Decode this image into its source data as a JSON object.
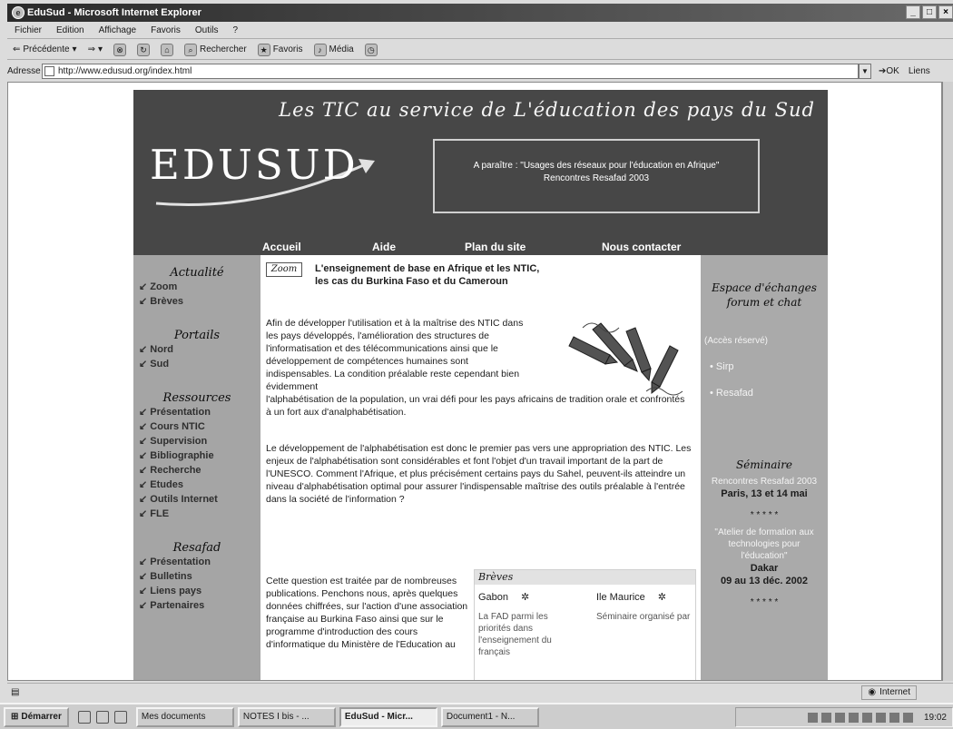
{
  "window": {
    "title": "EduSud - Microsoft Internet Explorer",
    "controls": [
      "_",
      "□",
      "×"
    ]
  },
  "menu": [
    "Fichier",
    "Edition",
    "Affichage",
    "Favoris",
    "Outils",
    "?"
  ],
  "toolbar": {
    "back": "Précédente",
    "search": "Rechercher",
    "favorites": "Favoris",
    "media": "Média"
  },
  "address": {
    "label": "Adresse",
    "url": "http://www.edusud.org/index.html",
    "go": "OK",
    "links": "Liens"
  },
  "site": {
    "tagline": "Les TIC au service de L'éducation des pays du Sud",
    "logo": "EDUSUD",
    "announce_line1": "A paraître : \"Usages des réseaux pour l'éducation en Afrique\"",
    "announce_line2": "Rencontres Resafad 2003",
    "nav": [
      "Accueil",
      "Aide",
      "Plan du site",
      "Nous contacter"
    ],
    "left": {
      "actualite_title": "Actualité",
      "actualite": [
        "Zoom",
        "Brèves"
      ],
      "portails_title": "Portails",
      "portails": [
        "Nord",
        "Sud"
      ],
      "ressources_title": "Ressources",
      "ressources": [
        "Présentation",
        "Cours NTIC",
        "Supervision",
        "Bibliographie",
        "Recherche",
        "Etudes",
        "Outils Internet",
        "FLE"
      ],
      "resafad_title": "Resafad",
      "resafad": [
        "Présentation",
        "Bulletins",
        "Liens pays",
        "Partenaires"
      ]
    },
    "article": {
      "tag": "Zoom",
      "title_line1": "L'enseignement de base en Afrique et les NTIC,",
      "title_line2": "les cas du Burkina Faso et du Cameroun",
      "p1": "Afin de développer l'utilisation et à la maîtrise des NTIC dans les pays développés, l'amélioration des structures de l'informatisation et des télécommunications ainsi que le développement de compétences humaines sont indispensables. La condition préalable reste cependant bien évidemment",
      "p1b": "l'alphabétisation de la population, un vrai défi pour les pays africains de tradition orale et confrontés à un fort aux d'analphabétisation.",
      "p2": "Le développement de l'alphabétisation est donc le premier pas vers une appropriation des NTIC. Les enjeux de l'alphabétisation sont considérables et font l'objet d'un travail important de la part de l'UNESCO. Comment l'Afrique, et plus précisément certains pays du Sahel, peuvent-ils atteindre un niveau d'alphabétisation optimal pour assurer l'indispensable maîtrise des outils préalable à l'entrée dans la société de l'information ?",
      "p3": "Cette question est traitée par de nombreuses publications. Penchons nous, après quelques données chiffrées, sur l'action d'une association française au Burkina Faso ainsi que sur le programme d'introduction des cours d'informatique du Ministère de l'Education au"
    },
    "breves": {
      "title": "Brèves",
      "item1_title": "Gabon",
      "item1_text": "La FAD parmi les priorités dans l'enseignement du français",
      "item2_title": "Ile Maurice",
      "item2_text": "Séminaire organisé par"
    },
    "right": {
      "espace_title": "Espace d'échanges forum et chat",
      "acces": "(Accès réservé)",
      "links": [
        "Sirp",
        "Resafad"
      ],
      "seminaire_title": "Séminaire",
      "sem1_text": "Rencontres Resafad 2003",
      "sem1_bold": "Paris, 13 et 14 mai",
      "stars": "* * * * *",
      "sem2_text": "\"Atelier de formation aux technologies pour l'éducation\"",
      "sem2_place": "Dakar",
      "sem2_date": "09 au 13 déc. 2002",
      "stars2": "* * * * *"
    }
  },
  "status": {
    "zone": "Internet"
  },
  "taskbar": {
    "start": "Démarrer",
    "tasks": [
      "Mes documents",
      "NOTES I bis - ...",
      "EduSud - Micr...",
      "Document1 - N..."
    ],
    "clock": "19:02"
  }
}
